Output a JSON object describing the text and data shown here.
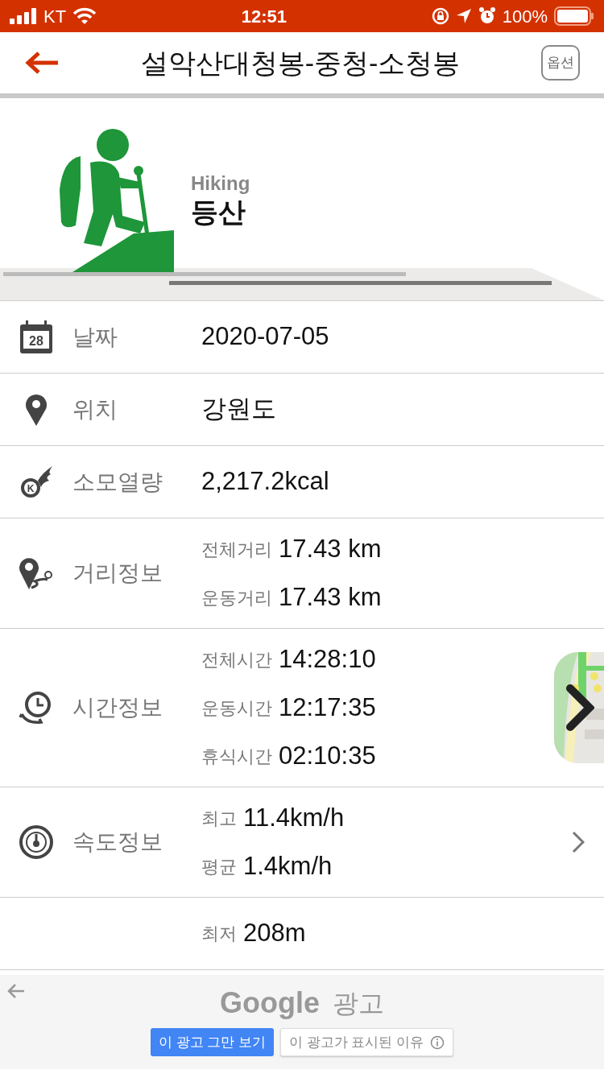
{
  "status_bar": {
    "carrier": "KT",
    "time": "12:51",
    "battery": "100%"
  },
  "header": {
    "title": "설악산대청봉-중청-소청봉",
    "option_button": "옵션"
  },
  "activity": {
    "english": "Hiking",
    "korean": "등산"
  },
  "rows": [
    {
      "icon_text": "28",
      "label": "날짜",
      "value": "2020-07-05",
      "chevron": false,
      "map_preview": false
    },
    {
      "label": "위치",
      "value": "강원도",
      "chevron": false,
      "map_preview": false
    },
    {
      "icon_text": "K",
      "label": "소모열량",
      "value": "2,217.2kcal",
      "chevron": false,
      "map_preview": false
    },
    {
      "label": "거리정보",
      "details": [
        {
          "label": "전체거리",
          "value": "17.43 km"
        },
        {
          "label": "운동거리",
          "value": "17.43 km"
        }
      ],
      "chevron": false,
      "map_preview": false
    },
    {
      "label": "시간정보",
      "details": [
        {
          "label": "전체시간",
          "value": "14:28:10"
        },
        {
          "label": "운동시간",
          "value": "12:17:35"
        },
        {
          "label": "휴식시간",
          "value": "02:10:35"
        }
      ],
      "chevron": true,
      "map_preview": true
    },
    {
      "label": "속도정보",
      "details": [
        {
          "label": "최고",
          "value": "11.4km/h"
        },
        {
          "label": "평균",
          "value": "1.4km/h"
        }
      ],
      "chevron": true,
      "map_preview": false
    },
    {
      "details": [
        {
          "label": "최저",
          "value": "208m"
        }
      ],
      "chevron": false,
      "map_preview": false
    }
  ],
  "ad": {
    "brand": "Google",
    "title": "광고",
    "buttons": [
      {
        "label": "이 광고 그만 보기",
        "kind": "primary"
      },
      {
        "label": "이 광고가 표시된 이유",
        "kind": "info"
      }
    ]
  }
}
